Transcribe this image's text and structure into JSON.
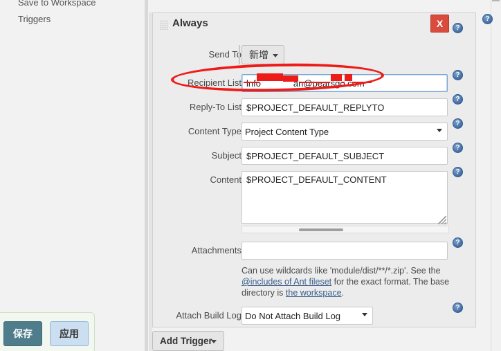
{
  "sidebar": {
    "items": [
      {
        "label": "Save to Workspace",
        "clipped": true
      },
      {
        "label": "Triggers",
        "clipped": false
      }
    ],
    "save_panel": {
      "save_label": "保存",
      "apply_label": "应用"
    }
  },
  "panel": {
    "title": "Always",
    "grip_icon": "drag-handle-icon",
    "close_label": "X",
    "rows": {
      "send_to": {
        "label": "Send To",
        "button_label": "新增",
        "caret_icon": "chevron-down-icon"
      },
      "recipient_list": {
        "label": "Recipient List",
        "value": "lnfo             an@pearsgo.com",
        "placeholder": "",
        "focused": true,
        "annotated": true
      },
      "reply_to_list": {
        "label": "Reply-To List",
        "value": "$PROJECT_DEFAULT_REPLYTO",
        "placeholder": ""
      },
      "content_type": {
        "label": "Content Type",
        "value": "Project Content Type",
        "options": [
          "Project Content Type"
        ]
      },
      "subject": {
        "label": "Subject",
        "value": "$PROJECT_DEFAULT_SUBJECT",
        "placeholder": ""
      },
      "content": {
        "label": "Content",
        "value": "$PROJECT_DEFAULT_CONTENT",
        "placeholder": ""
      },
      "attachments": {
        "label": "Attachments",
        "value": "",
        "placeholder": "",
        "help_text_1": "Can use wildcards like 'module/dist/**/*.zip'. See the",
        "help_link_1": "@includes of Ant fileset",
        "help_text_2": "for the exact format. The base",
        "help_text_3": "directory is",
        "help_link_2": "the workspace",
        "help_text_4": "."
      },
      "attach_build_log": {
        "label": "Attach Build Log",
        "value": "Do Not Attach Build Log",
        "options": [
          "Do Not Attach Build Log"
        ]
      }
    }
  },
  "add_trigger": {
    "label": "Add Trigger",
    "caret_icon": "chevron-down-icon"
  },
  "help_icons": {
    "label": "?",
    "name": "help-icon"
  },
  "colors": {
    "annotation_red": "#ee1c18",
    "close_red": "#d94b3c",
    "save_teal": "#4f7d8c",
    "apply_blue": "#ccdff0",
    "help_blue": "#2f5a93",
    "link_blue": "#3b5e8c"
  }
}
